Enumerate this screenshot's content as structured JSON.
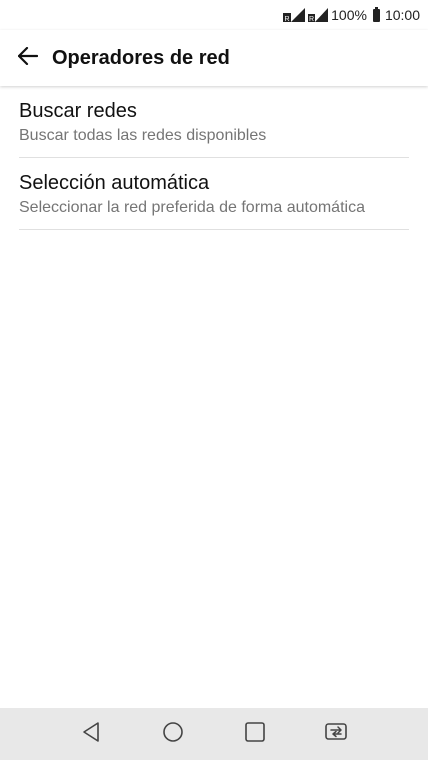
{
  "status_bar": {
    "battery_percent": "100%",
    "time": "10:00",
    "icons": [
      "signal-icon",
      "signal-icon",
      "battery-icon"
    ]
  },
  "app_bar": {
    "title": "Operadores de red",
    "back_icon": "back-arrow-icon"
  },
  "items": [
    {
      "title": "Buscar redes",
      "summary": "Buscar todas las redes disponibles"
    },
    {
      "title": "Selección automática",
      "summary": "Seleccionar la red preferida de forma automática"
    }
  ],
  "nav_bar": {
    "buttons": [
      "back-triangle-icon",
      "home-circle-icon",
      "recents-square-icon",
      "dual-window-icon"
    ]
  },
  "colors": {
    "nav_bar_bg": "#e8e8e8",
    "summary_text": "#757575",
    "divider": "#e0e0e0"
  }
}
